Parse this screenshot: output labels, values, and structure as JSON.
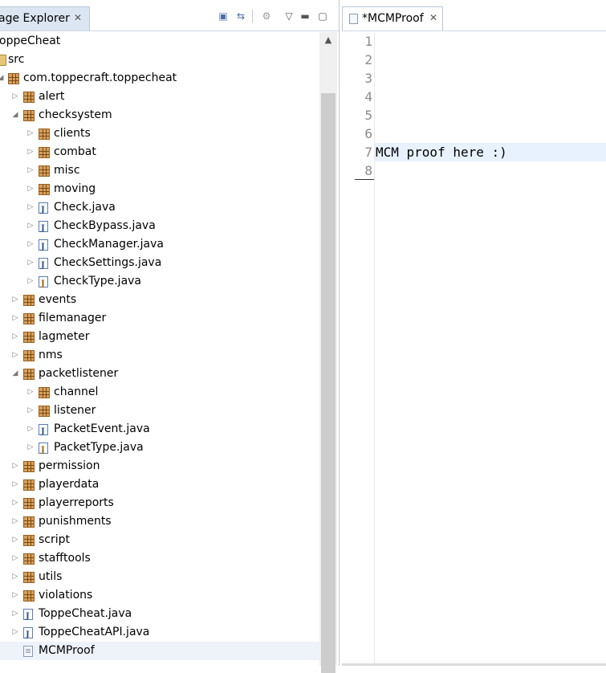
{
  "package_explorer": {
    "tab_title": "age Explorer",
    "tree": [
      {
        "label": "oppeCheat",
        "kind": "project",
        "twisty": "",
        "depth": 0
      },
      {
        "label": "src",
        "kind": "srcfolder",
        "twisty": "",
        "depth": 0
      },
      {
        "label": "com.toppecraft.toppecheat",
        "kind": "package",
        "twisty": "expanded",
        "depth": 0
      },
      {
        "label": "alert",
        "kind": "package",
        "twisty": "collapsed",
        "depth": 1
      },
      {
        "label": "checksystem",
        "kind": "package",
        "twisty": "expanded",
        "depth": 1
      },
      {
        "label": "clients",
        "kind": "package",
        "twisty": "collapsed",
        "depth": 2
      },
      {
        "label": "combat",
        "kind": "package",
        "twisty": "collapsed",
        "depth": 2
      },
      {
        "label": "misc",
        "kind": "package",
        "twisty": "collapsed",
        "depth": 2
      },
      {
        "label": "moving",
        "kind": "package",
        "twisty": "collapsed",
        "depth": 2
      },
      {
        "label": "Check.java",
        "kind": "java",
        "twisty": "collapsed",
        "depth": 2
      },
      {
        "label": "CheckBypass.java",
        "kind": "java",
        "twisty": "collapsed",
        "depth": 2
      },
      {
        "label": "CheckManager.java",
        "kind": "java",
        "twisty": "collapsed",
        "depth": 2
      },
      {
        "label": "CheckSettings.java",
        "kind": "java",
        "twisty": "collapsed",
        "depth": 2
      },
      {
        "label": "CheckType.java",
        "kind": "enum",
        "twisty": "collapsed",
        "depth": 2
      },
      {
        "label": "events",
        "kind": "package",
        "twisty": "collapsed",
        "depth": 1
      },
      {
        "label": "filemanager",
        "kind": "package",
        "twisty": "collapsed",
        "depth": 1
      },
      {
        "label": "lagmeter",
        "kind": "package",
        "twisty": "collapsed",
        "depth": 1
      },
      {
        "label": "nms",
        "kind": "package",
        "twisty": "collapsed",
        "depth": 1
      },
      {
        "label": "packetlistener",
        "kind": "package",
        "twisty": "expanded",
        "depth": 1
      },
      {
        "label": "channel",
        "kind": "package",
        "twisty": "collapsed",
        "depth": 2
      },
      {
        "label": "listener",
        "kind": "package",
        "twisty": "collapsed",
        "depth": 2
      },
      {
        "label": "PacketEvent.java",
        "kind": "java",
        "twisty": "collapsed",
        "depth": 2
      },
      {
        "label": "PacketType.java",
        "kind": "enum",
        "twisty": "collapsed",
        "depth": 2
      },
      {
        "label": "permission",
        "kind": "package",
        "twisty": "collapsed",
        "depth": 1
      },
      {
        "label": "playerdata",
        "kind": "package",
        "twisty": "collapsed",
        "depth": 1
      },
      {
        "label": "playerreports",
        "kind": "package",
        "twisty": "collapsed",
        "depth": 1
      },
      {
        "label": "punishments",
        "kind": "package",
        "twisty": "collapsed",
        "depth": 1
      },
      {
        "label": "script",
        "kind": "package",
        "twisty": "collapsed",
        "depth": 1
      },
      {
        "label": "stafftools",
        "kind": "package",
        "twisty": "collapsed",
        "depth": 1
      },
      {
        "label": "utils",
        "kind": "package",
        "twisty": "collapsed",
        "depth": 1
      },
      {
        "label": "violations",
        "kind": "package",
        "twisty": "collapsed",
        "depth": 1
      },
      {
        "label": "ToppeCheat.java",
        "kind": "java",
        "twisty": "collapsed",
        "depth": 1
      },
      {
        "label": "ToppeCheatAPI.java",
        "kind": "java",
        "twisty": "collapsed",
        "depth": 1
      },
      {
        "label": "MCMProof",
        "kind": "text",
        "twisty": "",
        "depth": 1,
        "selected": true
      }
    ]
  },
  "editor": {
    "tab_title": "*MCMProof",
    "lines": [
      {
        "num": "1",
        "text": ""
      },
      {
        "num": "2",
        "text": ""
      },
      {
        "num": "3",
        "text": ""
      },
      {
        "num": "4",
        "text": ""
      },
      {
        "num": "5",
        "text": ""
      },
      {
        "num": "6",
        "text": ""
      },
      {
        "num": "7",
        "text": "MCM proof here :)"
      },
      {
        "num": "8",
        "text": ""
      }
    ]
  }
}
